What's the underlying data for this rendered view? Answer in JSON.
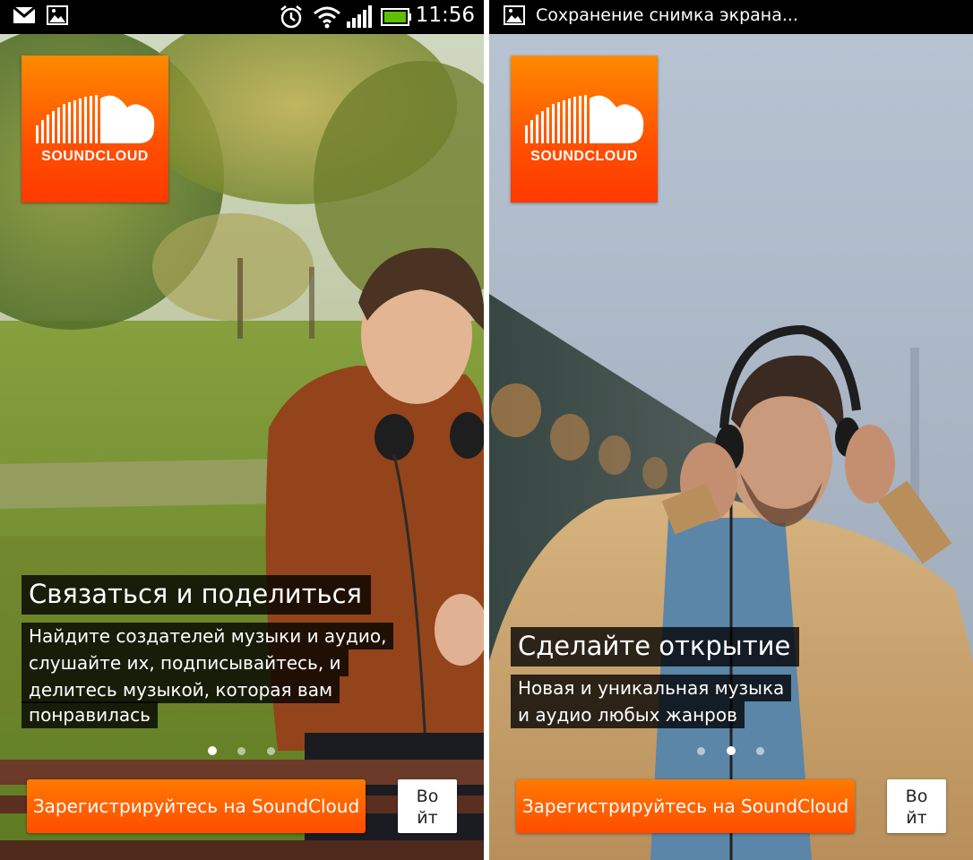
{
  "status_bar": {
    "time": "11:56",
    "notification_text": "Сохранение снимка экрана..."
  },
  "brand": {
    "logo_text": "SOUNDCLOUD",
    "accent_color": "#ff5500"
  },
  "slides": [
    {
      "title": "Связаться и поделиться",
      "description_lines": [
        "Найдите создателей музыки и аудио,",
        "слушайте их, подписывайтесь, и",
        "делитесь музыкой, которая вам",
        "понравилась"
      ],
      "active_page": 1,
      "page_count": 3
    },
    {
      "title": "Сделайте открытие",
      "description_lines": [
        "Новая и уникальная музыка",
        "и аудио любых жанров"
      ],
      "active_page": 2,
      "page_count": 3
    }
  ],
  "buttons": {
    "signup_label": "Зарегистрируйтесь на SoundCloud",
    "login_label_line1": "Во",
    "login_label_line2": "йт"
  }
}
